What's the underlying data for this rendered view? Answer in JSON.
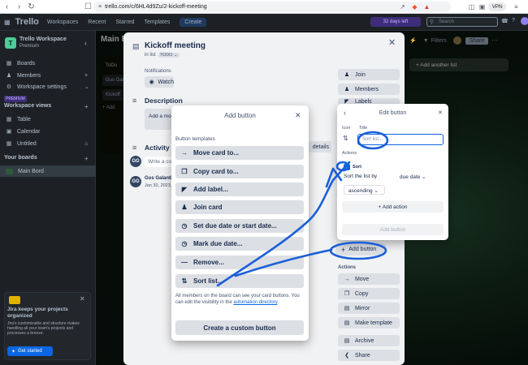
{
  "browser": {
    "url": "trello.com/c/6HL4d9Zu/2-kickoff-meeting",
    "vpn": "VPN"
  },
  "header": {
    "logo": "Trello",
    "menus": [
      "Workspaces",
      "Recent",
      "Starred",
      "Templates"
    ],
    "create": "Create",
    "trial": "32 days left",
    "search_placeholder": "Search"
  },
  "sidebar": {
    "workspace_name": "Trello Workspace",
    "workspace_plan": "Premium",
    "workspace_initial": "T",
    "items": [
      {
        "label": "Boards",
        "icon": "board-icon"
      },
      {
        "label": "Members",
        "icon": "person-icon"
      },
      {
        "label": "Workspace settings",
        "icon": "gear-icon"
      }
    ],
    "trial_tag": "PREMIUM",
    "views_title": "Workspace views",
    "views": [
      {
        "label": "Table"
      },
      {
        "label": "Calendar"
      },
      {
        "label": "Untitled"
      }
    ],
    "boards_title": "Your boards",
    "boards": [
      {
        "label": "Main Bord"
      }
    ],
    "promo": {
      "title": "Jira keeps your projects organized",
      "body": "Jira's customizable and structure makes handling all your team's projects and processes a breeze.",
      "cta": "Get started"
    }
  },
  "board": {
    "title": "Main B",
    "lists": [
      "ToDo",
      "Gus Gal",
      "Kickoff"
    ],
    "add_card": "+ Add",
    "add_list": "+ Add another list",
    "filters": "Filters",
    "share": "Share"
  },
  "card": {
    "title": "Kickoff meeting",
    "in_list_prefix": "in list",
    "list_name": "TODO",
    "notifications_label": "Notifications",
    "watch_label": "Watch",
    "description_label": "Description",
    "description_placeholder": "Add a mo",
    "activity_label": "Activity",
    "details_button": "details",
    "comment_placeholder": "Write a co",
    "activity_user_initials": "GG",
    "activity_user": "Gus Galanti",
    "activity_date": "Jan 30, 2023,",
    "sidebar_buttons": [
      {
        "label": "Join"
      },
      {
        "label": "Members"
      },
      {
        "label": "Labels"
      }
    ],
    "add_button_label": "Add button",
    "actions_label": "Actions",
    "actions": [
      {
        "label": "Move",
        "icon": "arrow-right-icon"
      },
      {
        "label": "Copy",
        "icon": "copy-icon"
      },
      {
        "label": "Mirror",
        "icon": "mirror-icon"
      },
      {
        "label": "Make template",
        "icon": "template-icon"
      },
      {
        "label": "Archive",
        "icon": "archive-icon"
      },
      {
        "label": "Share",
        "icon": "share-icon"
      }
    ]
  },
  "add_button_popup": {
    "title": "Add button",
    "section_label": "Button templates",
    "templates": [
      {
        "label": "Move card to...",
        "icon": "arrow-right-icon"
      },
      {
        "label": "Copy card to...",
        "icon": "copy-icon"
      },
      {
        "label": "Add label...",
        "icon": "tag-icon"
      },
      {
        "label": "Join card",
        "icon": "person-icon"
      },
      {
        "label": "Set due date or start date...",
        "icon": "clock-icon"
      },
      {
        "label": "Mark due date...",
        "icon": "clock-icon"
      },
      {
        "label": "Remove...",
        "icon": "minus-icon"
      },
      {
        "label": "Sort list...",
        "icon": "sort-icon"
      }
    ],
    "footer_note": "All members on the board can see your card buttons. You can edit the visibility in the",
    "footer_link": "automation directory",
    "footer_end": ".",
    "create_custom": "Create a custom button"
  },
  "edit_popup": {
    "title": "Edit button",
    "icon_label": "Icon",
    "title_label": "Title",
    "title_placeholder": "Sort list...",
    "actions_label": "Actions",
    "action_tag": "Sort",
    "sort_prefix": "Sort the list by",
    "sort_by": "due date",
    "sort_order": "ascending",
    "add_action": "+ Add action",
    "add_button": "Add button"
  },
  "colors": {
    "accent": "#0c66e4",
    "annotation": "#1a5fd8"
  }
}
